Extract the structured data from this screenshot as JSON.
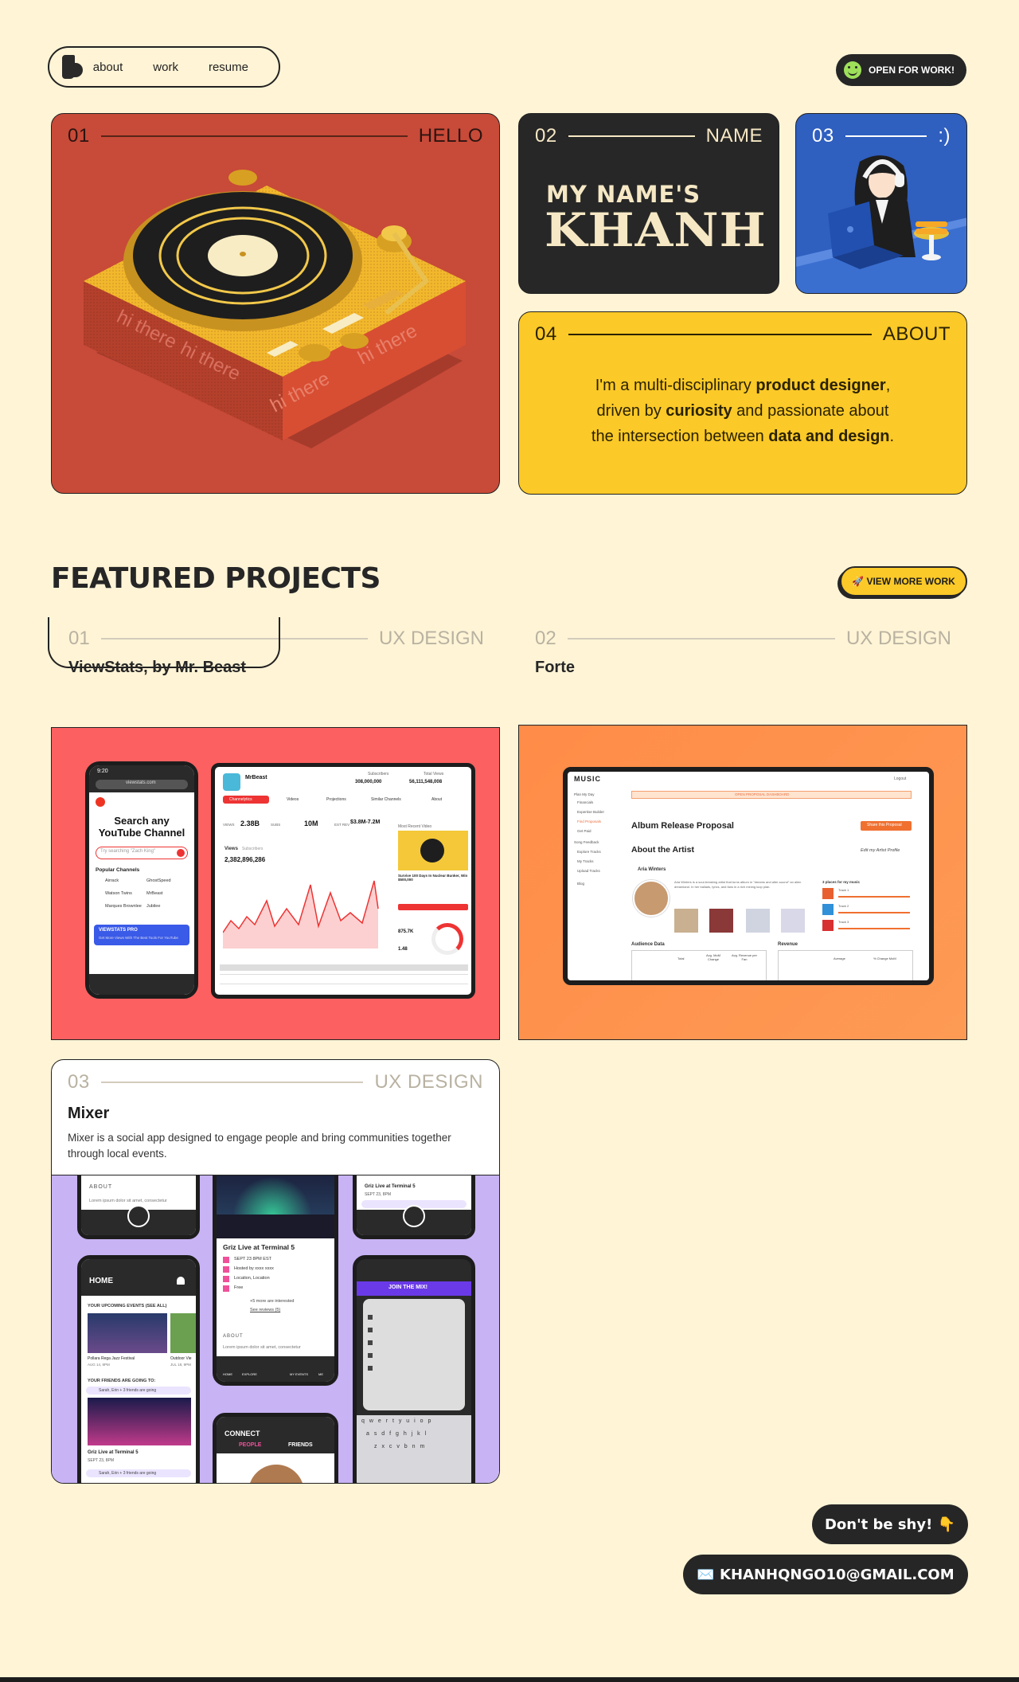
{
  "nav": {
    "links": [
      "about",
      "work",
      "resume"
    ],
    "status_label": "OPEN FOR WORK!"
  },
  "cards": {
    "hello": {
      "num": "01",
      "label": "HELLO",
      "turntable_text": "hi there"
    },
    "name": {
      "num": "02",
      "label": "NAME",
      "line1": "MY NAME'S",
      "line2": "KHANH"
    },
    "avatar": {
      "num": "03",
      "label": ":)"
    },
    "about": {
      "num": "04",
      "label": "ABOUT"
    }
  },
  "about_text": {
    "p1": "I'm a multi-disciplinary ",
    "b1": "product designer",
    "p2": ",",
    "p3": "driven by ",
    "b2": "curiosity",
    "p4": " and passionate about",
    "p5": "the intersection between ",
    "b3": "data and design",
    "p6": "."
  },
  "featured": {
    "title": "FEATURED PROJECTS",
    "view_more": "🚀 VIEW MORE WORK"
  },
  "projects": [
    {
      "num": "01",
      "category": "UX DESIGN",
      "title": "ViewStats, by Mr. Beast"
    },
    {
      "num": "02",
      "category": "UX DESIGN",
      "title": "Forte"
    },
    {
      "num": "03",
      "category": "UX DESIGN",
      "title": "Mixer",
      "description": "Mixer is a social app designed to engage people and bring communities together through local events."
    }
  ],
  "viewstats": {
    "time": "9:20",
    "url": "viewstats.com",
    "headline": "Search any YouTube Channel",
    "search_placeholder": "Try searching \"Zach King\"",
    "popular_label": "Popular Channels",
    "channels": [
      "Airrack",
      "GhostSpeed",
      "Watson Twins",
      "MrBeast",
      "Marques Brownlee",
      "Jubilee"
    ],
    "banner": "VIEWSTATS PRO",
    "banner_sub": "Get More Views With The Best Tools For YouTube",
    "channel_name": "MrBeast",
    "subscribers_label": "Subscribers",
    "subscribers": "308,000,000",
    "total_views_label": "Total Views",
    "total_views": "56,111,548,008",
    "tabs": [
      "Channelytics",
      "Videos",
      "Projections",
      "Similar Channels",
      "About"
    ],
    "stats": [
      {
        "label": "VIEWS",
        "value": "2.38B"
      },
      {
        "label": "SUBS",
        "value": "10M"
      },
      {
        "label": "EST REV",
        "value": "$3.8M-7.2M"
      }
    ],
    "views_label": "Views",
    "subs_tab": "Subscribers",
    "views_total": "2,382,896,286",
    "most_recent": "Most Recent Video",
    "video_title": "Survive 100 Days In Nuclear Bunker, Win $500,000",
    "score": "875.7K",
    "rank": "1.48"
  },
  "forte": {
    "logo": "MUSIC",
    "banner": "OPEN PROPOSAL DASHBOARD",
    "sidebar": [
      "Plan My Day",
      "Financials",
      "Expertise Builder",
      "Find Proposals",
      "Get Paid",
      "Song Feedback",
      "Explore Tracks",
      "My Tracks",
      "Upload Tracks",
      "Blog"
    ],
    "title": "Album Release Proposal",
    "share": "Share this Proposal",
    "about_artist": "About the Artist",
    "edit": "Edit my Artist Profile",
    "artist": "Aria Winters",
    "bio": "Aria Winters is a soul-breaking artist that turns album in \"dreams and alter-sound\" an alien dreamland. In her ballads, lyrics, and fans in a rich mining loop plan.",
    "tracks_title": "3 places for my music",
    "tracks": [
      "Track 1",
      "Track 2",
      "Track 3"
    ],
    "audience": "Audience Data",
    "revenue": "Revenue",
    "audience_cols": [
      "Total",
      "Avg. MoM Change",
      "Avg. Revenue per Fan"
    ],
    "revenue_cols": [
      "Average",
      "% Change MoM"
    ],
    "logout": "Logout"
  },
  "mixer": {
    "about": "ABOUT",
    "lorem": "Lorem ipsum dolor sit amet, consectetur",
    "event_title": "Griz Live at Terminal 5",
    "event_date": "SEPT 23, 8PM",
    "event_time": "SEPT 23 8PM EST",
    "hosted": "Hosted by xxxx xxxx",
    "location": "Location, Location",
    "price": "Free",
    "interested": "+5 more are interested",
    "reviews": "See reviews (5)",
    "friends_going": "Sarah, Erin + 3 friends are going",
    "home": "HOME",
    "upcoming": "YOUR UPCOMING EVENTS (SEE ALL)",
    "events": [
      "Pollara Rega Jazz Festival",
      "Outdoor Vie"
    ],
    "event_dates": [
      "AUG 14, 8PM",
      "JUL 18, 9PM"
    ],
    "friends_going_to": "YOUR FRIENDS ARE GOING TO:",
    "connect": "CONNECT",
    "people": "PEOPLE",
    "friends": "FRIENDS",
    "join": "JOIN THE MIX!",
    "nav": [
      "HOME",
      "EXPLORE",
      "MY EVENTS",
      "ME"
    ],
    "keyboard_rows": [
      "q w e r t y u i o p",
      "a s d f g h j k l",
      "z x c v b n m"
    ]
  },
  "contact": {
    "shy": "Don't be shy! 👇",
    "email": "✉️ KHANHQNGO10@GMAIL.COM"
  },
  "colors": {
    "background": "#fff4d6",
    "dark": "#262626",
    "red": "#c84a38",
    "yellow": "#fbc928",
    "blue": "#2f5fbf",
    "coral": "#fd6060",
    "orange": "#ff8c48",
    "lavender": "#c8b3f5"
  }
}
